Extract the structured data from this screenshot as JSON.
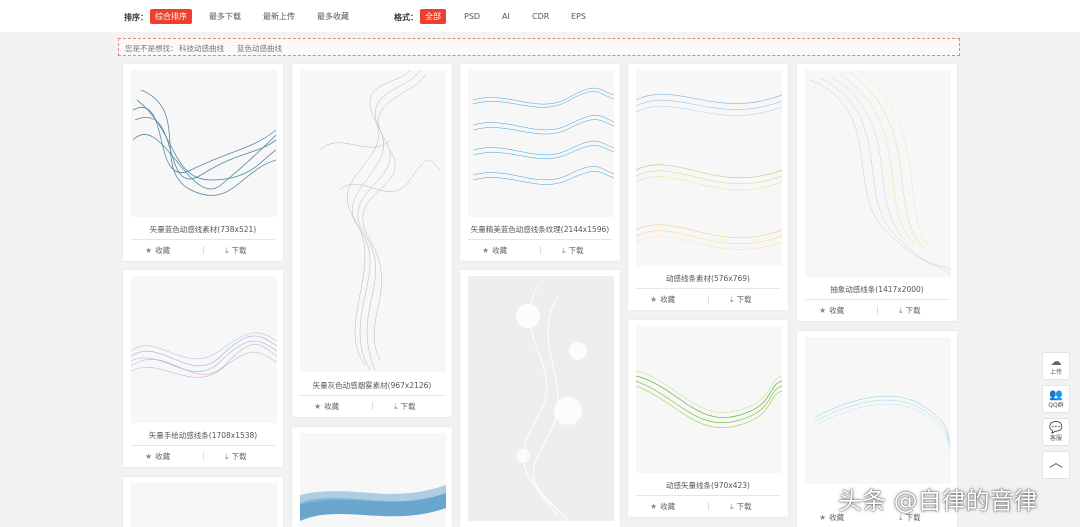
{
  "toolbar": {
    "sort_label": "排序：",
    "sort_options": [
      "综合排序",
      "最多下载",
      "最新上传",
      "最多收藏"
    ],
    "format_label": "格式：",
    "format_options": [
      "全部",
      "PSD",
      "AI",
      "CDR",
      "EPS"
    ],
    "accent_color": "#ee3f2d"
  },
  "suggest": {
    "prefix": "您是不是想找：",
    "link1": "科技动感曲线",
    "link2": "蓝色动感曲线"
  },
  "cards": [
    {
      "title": "矢量蓝色动感线素材(738x521)",
      "thumb_icon": "blue-curve-lines-image"
    },
    {
      "title": "矢量手绘动感线条(1708x1538)",
      "thumb_icon": "pastel-wave-lines-image"
    },
    {
      "title": "",
      "thumb_icon": "partial-image"
    },
    {
      "title": "矢量灰色动感烟雾素材(967x2126)",
      "thumb_icon": "gray-smoke-image"
    },
    {
      "title": "",
      "thumb_icon": "blue-wave-partial-image"
    },
    {
      "title": "矢量精美蓝色动感线条纹理(2144x1596)",
      "thumb_icon": "blue-ribbon-lines-image"
    },
    {
      "title": "",
      "thumb_icon": "white-light-curves-image"
    },
    {
      "title": "动感线条素材(576x769)",
      "thumb_icon": "colorful-ribbons-image"
    },
    {
      "title": "动感矢量线条(970x423)",
      "thumb_icon": "green-wave-image"
    },
    {
      "title": "抽象动感线条(1417x2000)",
      "thumb_icon": "pink-line-wave-image"
    },
    {
      "title": "",
      "thumb_icon": "cyan-wave-image"
    }
  ],
  "actions": {
    "collect": "收藏",
    "download": "下载",
    "collect_icon": "star-icon",
    "download_icon": "download-icon"
  },
  "sidebar": {
    "upload": "上传",
    "qq_group": "QQ群",
    "feedback": "客服",
    "top_icon": "chevron-up-icon"
  },
  "watermark": "头条 @自律的音律"
}
